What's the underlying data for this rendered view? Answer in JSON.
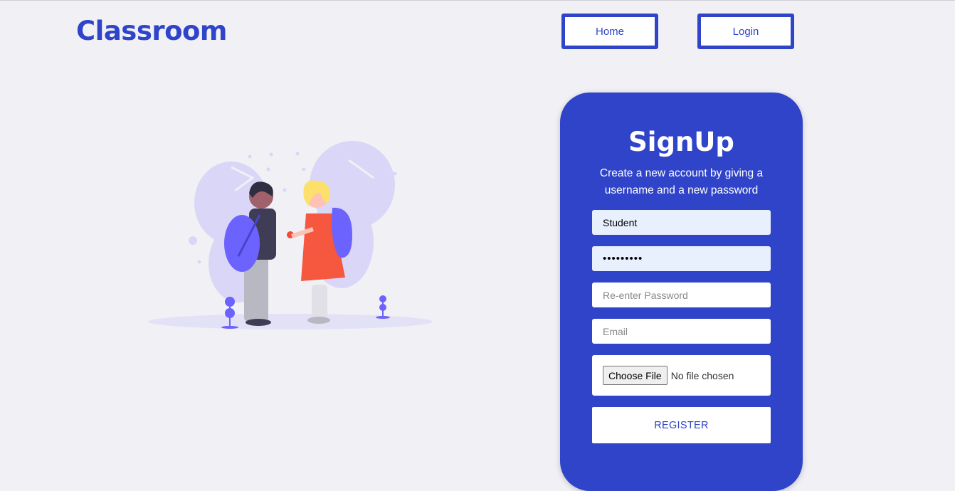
{
  "app": {
    "logo": "Classroom",
    "accent": "#2f44c9",
    "background": "#f1f0f5"
  },
  "nav": {
    "home_label": "Home",
    "login_label": "Login"
  },
  "illustration": {
    "name": "students-with-backpacks"
  },
  "signup": {
    "title": "SignUp",
    "subtitle": "Create a new account by giving a username and a new password",
    "username_value": "Student",
    "password_value": "•••••••••",
    "reenter_placeholder": "Re-enter Password",
    "email_placeholder": "Email",
    "file_button_label": "Choose File",
    "file_status": "No file chosen",
    "register_label": "REGISTER"
  }
}
